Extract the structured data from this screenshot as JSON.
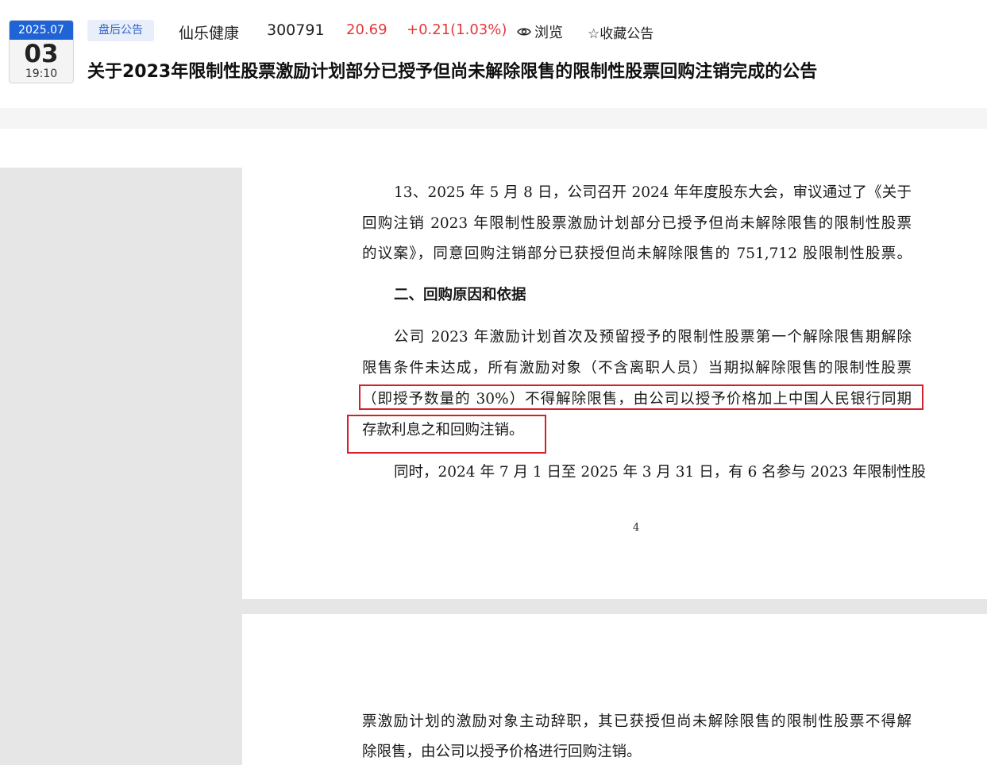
{
  "header": {
    "date": {
      "year_month": "2025.07",
      "day": "03",
      "time": "19:10"
    },
    "tag": "盘后公告",
    "stock_name": "仙乐健康",
    "stock_code": "300791",
    "price": "20.69",
    "change": "+0.21(1.03%)",
    "views_label": "浏览",
    "favorite_label": "☆收藏公告",
    "title": "关于2023年限制性股票激励计划部分已授予但尚未解除限售的限制性股票回购注销完成的公告"
  },
  "colors": {
    "accent_blue": "#1f63d6",
    "price_red": "#e5383b",
    "highlight_red": "#d4202a"
  },
  "document": {
    "page1": {
      "lines": [
        "13、2025 年 5 月 8 日，公司召开 2024 年年度股东大会，审议通过了《关于",
        "回购注销 2023 年限制性股票激励计划部分已授予但尚未解除限售的限制性股票",
        "的议案》，同意回购注销部分已获授但尚未解除限售的 751,712 股限制性股票。"
      ],
      "heading": "二、回购原因和依据",
      "para2": [
        "公司 2023 年激励计划首次及预留授予的限制性股票第一个解除限售期解除",
        "限售条件未达成，所有激励对象（不含离职人员）当期拟解除限售的限制性股票",
        "（即授予数量的 30%）不得解除限售，由公司以授予价格加上中国人民银行同期",
        "存款利息之和回购注销。"
      ],
      "para3": "同时，2024 年 7 月 1 日至 2025 年 3 月 31 日，有 6 名参与 2023 年限制性股",
      "page_number": "4"
    },
    "page2": {
      "lines": [
        "票激励计划的激励对象主动辞职，其已获授但尚未解除限售的限制性股票不得解",
        "除限售，由公司以授予价格进行回购注销。"
      ]
    }
  }
}
